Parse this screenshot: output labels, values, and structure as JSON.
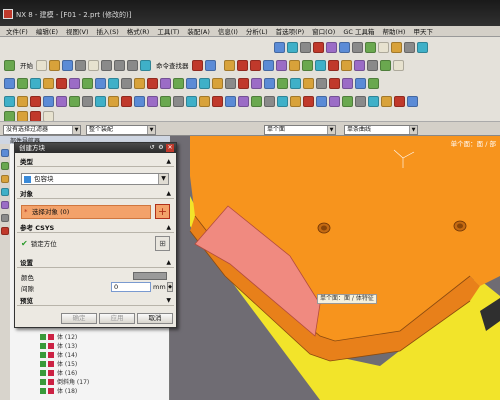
{
  "window": {
    "title": "NX 8 - 建模 - [F01 - 2.prt (修改的)]"
  },
  "menu": [
    "文件(F)",
    "编辑(E)",
    "视图(V)",
    "插入(S)",
    "格式(R)",
    "工具(T)",
    "装配(A)",
    "信息(I)",
    "分析(L)",
    "首选项(P)",
    "窗口(O)",
    "GC 工具箱",
    "帮助(H)",
    "甲天下"
  ],
  "toolbar": {
    "start_label": "开始",
    "command_finder_label": "命令查找器"
  },
  "selection_bar": {
    "filter_1": "没有选择过滤器",
    "filter_2": "整个装配",
    "face_rule": "单个面",
    "curve_rule": "单条曲线"
  },
  "navigator": {
    "header": "部件导航器",
    "items": [
      "体 (12)",
      "体 (13)",
      "体 (14)",
      "体 (15)",
      "体 (16)",
      "倒斜角 (17)",
      "体 (18)"
    ]
  },
  "dialog": {
    "title": "创建方块",
    "sections": {
      "type": "类型",
      "object": "对象",
      "csys": "参考 CSYS",
      "settings": "设置",
      "preview": "预览"
    },
    "type_value": "包容块",
    "select_object": "选择对象 (0)",
    "csys_label": "锁定方位",
    "color_label": "颜色",
    "offset_label": "间隙",
    "offset_value": "0",
    "offset_unit": "mm",
    "buttons": {
      "ok": "确定",
      "apply": "应用",
      "cancel": "取消"
    }
  },
  "viewport": {
    "selection_scope_label": "单个面：面 / 部"
  },
  "tooltip": "单个面：面 / 体特征",
  "colors": {
    "part": "#f7941d",
    "selected_face": "#f08a80",
    "bottom_face": "#f2e42a",
    "background": "#6f6c73"
  }
}
